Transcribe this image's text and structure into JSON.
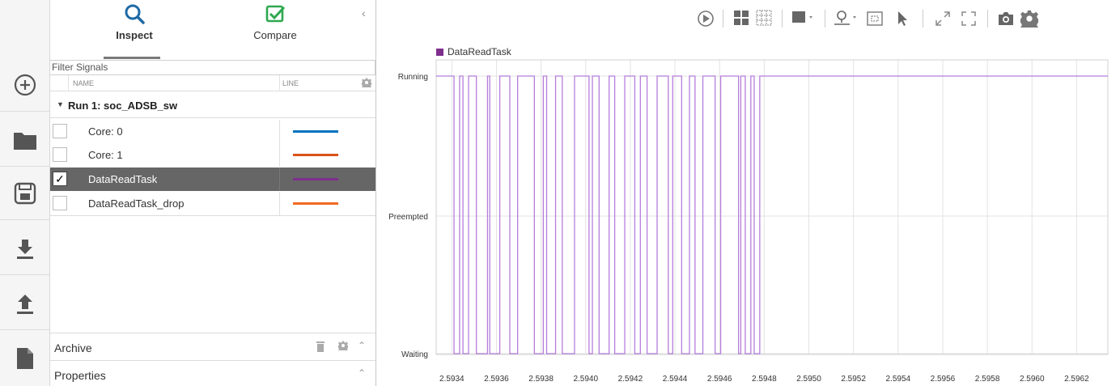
{
  "colors": {
    "inspect_icon": "#1f6aa5",
    "compare_icon": "#2fa84f",
    "selected_row": "#666666",
    "toolbar_icon": "#5a5a5a",
    "plot_line": "#b57edc",
    "legend_square": "#7e2f8e"
  },
  "left_toolbar": {
    "items": [
      {
        "name": "new-icon"
      },
      {
        "name": "open-folder-icon"
      },
      {
        "name": "save-icon"
      },
      {
        "name": "import-icon"
      },
      {
        "name": "export-icon"
      },
      {
        "name": "report-icon"
      }
    ]
  },
  "tabs": {
    "inspect": "Inspect",
    "compare": "Compare"
  },
  "filter": {
    "placeholder": "Filter Signals"
  },
  "columns": {
    "name": "NAME",
    "line": "LINE"
  },
  "run": {
    "label": "Run 1: soc_ADSB_sw"
  },
  "signals": [
    {
      "label": "Core: 0",
      "checked": false,
      "color": "#0072bd"
    },
    {
      "label": "Core: 1",
      "checked": false,
      "color": "#d95319"
    },
    {
      "label": "DataReadTask",
      "checked": true,
      "color": "#7e2f8e",
      "selected": true
    },
    {
      "label": "DataReadTask_drop",
      "checked": false,
      "color": "#f26b22"
    }
  ],
  "sections": {
    "archive": "Archive",
    "properties": "Properties"
  },
  "chart_data": {
    "type": "line",
    "series": [
      {
        "name": "DataReadTask",
        "color": "#b57edc",
        "states": [
          "Waiting",
          "Preempted",
          "Running"
        ],
        "transitions_x": [
          2.59341,
          2.593435,
          2.59345,
          2.593475,
          2.59351,
          2.59356,
          2.59357,
          2.593615,
          2.59366,
          2.593695,
          2.59377,
          2.59381,
          2.593825,
          2.593865,
          2.593895,
          2.59395,
          2.594015,
          2.59403,
          2.59406,
          2.594105,
          2.59413,
          2.594175,
          2.59422,
          2.594245,
          2.594275,
          2.59432,
          2.59437,
          2.59439,
          2.59443,
          2.594465,
          2.59449,
          2.594525,
          2.59458,
          2.594605,
          2.594685,
          2.594695,
          2.594715,
          2.59474,
          2.594755,
          2.59478
        ],
        "initial_state": "Running"
      }
    ],
    "y_categories": [
      "Waiting",
      "Preempted",
      "Running"
    ],
    "x_ticks": [
      "2.5934",
      "2.5936",
      "2.5938",
      "2.5940",
      "2.5942",
      "2.5944",
      "2.5946",
      "2.5948",
      "2.5950",
      "2.5952",
      "2.5954",
      "2.5956",
      "2.5958",
      "2.5960",
      "2.5962"
    ],
    "xlim": [
      2.59333,
      2.59634
    ],
    "grid": true,
    "legend": "top-left"
  }
}
